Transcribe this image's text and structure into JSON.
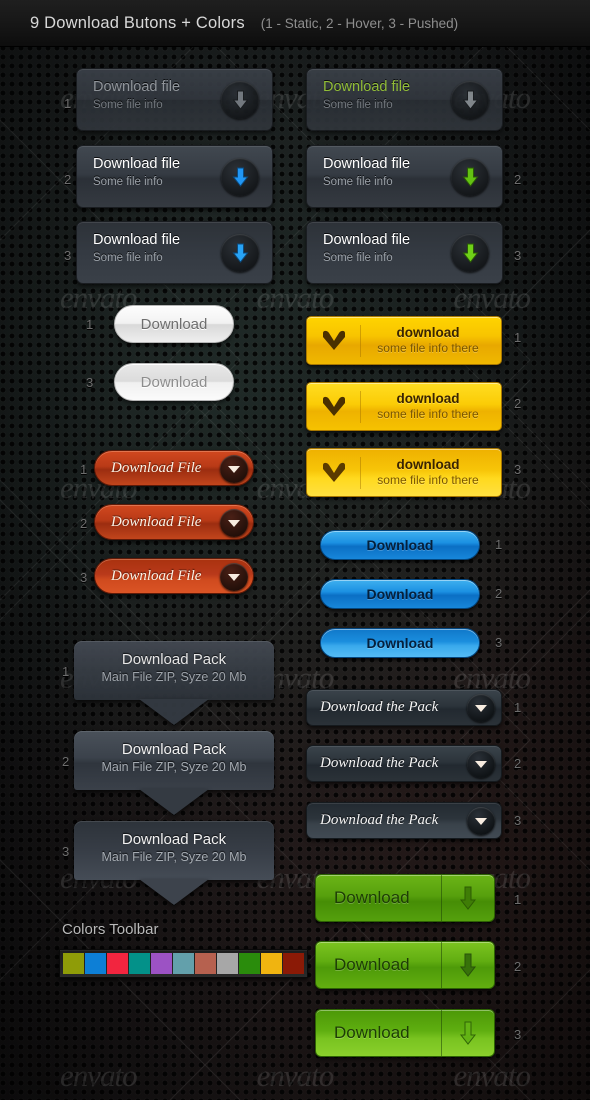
{
  "header": {
    "title": "9 Download Butons + Colors",
    "legend": "(1 - Static,  2 - Hover,  3 - Pushed)"
  },
  "state_labels": {
    "s1": "1",
    "s2": "2",
    "s3": "3"
  },
  "sets": {
    "dark_blue_card": {
      "title": "Download file",
      "subtitle": "Some file info",
      "icon": "arrow-down-icon",
      "accent": "#2196f3",
      "states": [
        "1",
        "2",
        "3"
      ]
    },
    "dark_green_card": {
      "title": "Download file",
      "subtitle": "Some file info",
      "icon": "arrow-down-icon",
      "accent": "#63c112",
      "states": [
        "1",
        "2",
        "3"
      ]
    },
    "white_pill": {
      "label": "Download",
      "states": [
        "1",
        "3"
      ]
    },
    "red_pill": {
      "label": "Download File",
      "icon": "triangle-down-icon",
      "accent": "#c2451c",
      "states": [
        "1",
        "2",
        "3"
      ]
    },
    "yellow_card": {
      "title": "download",
      "subtitle": "some file info there",
      "icon": "heart-icon",
      "accent": "#f8c400",
      "states": [
        "1",
        "2",
        "3"
      ]
    },
    "blue_pill": {
      "label": "Download",
      "accent": "#1b90e2",
      "states": [
        "1",
        "2",
        "3"
      ]
    },
    "pack_card": {
      "title": "Download Pack",
      "subtitle": "Main File ZIP, Syze 20 Mb",
      "icon": "arrow-tail-icon",
      "states": [
        "1",
        "2",
        "3"
      ]
    },
    "slate_pill": {
      "label": "Download the Pack",
      "icon": "triangle-down-icon",
      "states": [
        "1",
        "2",
        "3"
      ]
    },
    "green_split": {
      "label": "Download",
      "icon": "arrow-down-icon",
      "accent": "#61ad11",
      "states": [
        "1",
        "2",
        "3"
      ]
    }
  },
  "colors_toolbar": {
    "title": "Colors Toolbar",
    "swatches": [
      "#8f9c08",
      "#0d7fd6",
      "#f2253f",
      "#039189",
      "#9c52c4",
      "#63a0ab",
      "#b6614f",
      "#a7a7a7",
      "#2a8c0c",
      "#f0b410",
      "#8b1a06"
    ]
  },
  "watermark": {
    "text": "envato"
  }
}
